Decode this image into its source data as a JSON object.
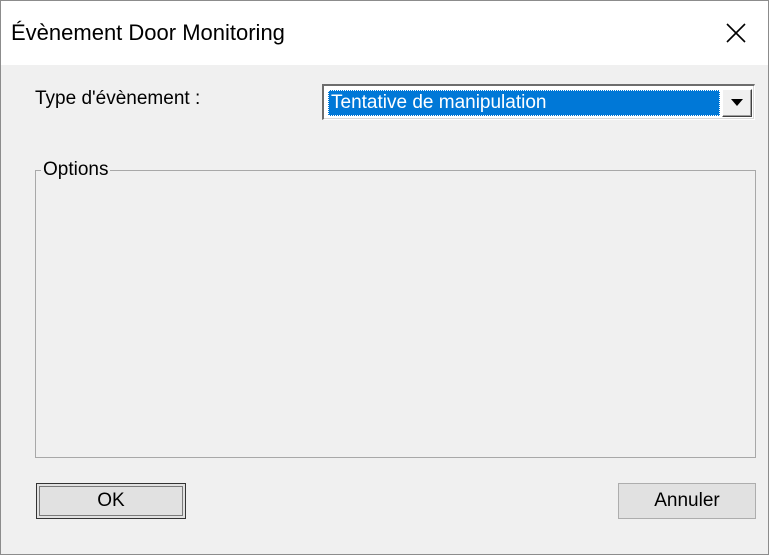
{
  "window": {
    "title": "Évènement Door Monitoring"
  },
  "form": {
    "event_type_label": "Type d'évènement :",
    "event_type_value": "Tentative de manipulation"
  },
  "options_group": {
    "label": "Options"
  },
  "buttons": {
    "ok_label": "OK",
    "cancel_label": "Annuler"
  },
  "colors": {
    "selection": "#0078d7",
    "dialog_bg": "#f0f0f0",
    "titlebar_bg": "#ffffff"
  },
  "icons": {
    "close": "close-icon",
    "dropdown": "chevron-down-icon"
  }
}
